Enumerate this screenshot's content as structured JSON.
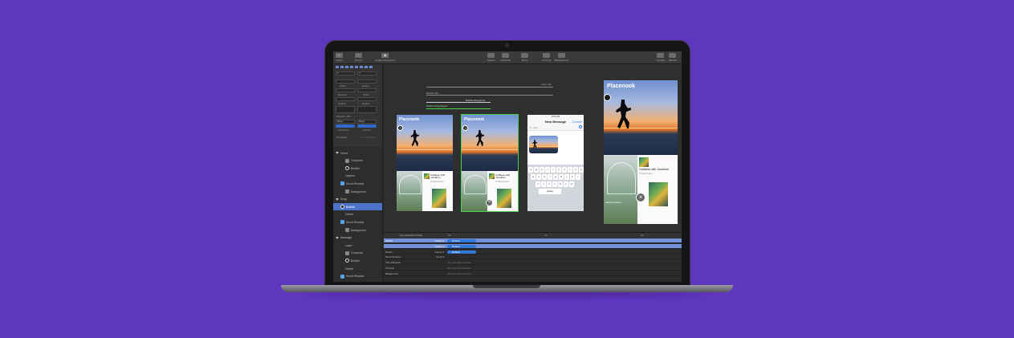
{
  "toolbar": {
    "left": [
      {
        "label": "Import",
        "icon": "import-icon"
      },
      {
        "label": "Export",
        "icon": "export-icon"
      },
      {
        "label": "Create Component",
        "icon": "component-icon"
      }
    ],
    "center": [
      {
        "label": "Screen",
        "icon": "screen-icon"
      },
      {
        "label": "Artboards",
        "icon": "artboard-icon"
      },
      {
        "label": "Mirror",
        "icon": "mirror-icon"
      },
      {
        "label": "Connect",
        "icon": "connect-icon"
      },
      {
        "label": "Backgrounds",
        "icon": "backgrounds-icon"
      }
    ],
    "right": [
      {
        "label": "Tutorials",
        "icon": "tutorials-icon"
      },
      {
        "label": "Manual",
        "icon": "manual-icon"
      }
    ]
  },
  "inspector": {
    "x": "X",
    "y": "Y",
    "width_label": "Width",
    "height_label": "Height",
    "rotation_label": "Rotation",
    "scale_label": "Scale",
    "opacity_label": "Opacity",
    "radius_label": "Radius",
    "shadow_label": "Shadow",
    "blur_label": "Blur",
    "horizontal_label": "Horizontal",
    "vertical_label": "Vertical",
    "drag_value": "Drag",
    "touchable_label": "Touchable",
    "no_selection_label": "Lock Selection"
  },
  "layers": [
    {
      "label": "Home",
      "indent": 0,
      "icon": "disclosure",
      "selected": false
    },
    {
      "label": "Compose",
      "indent": 2,
      "icon": "phone",
      "selected": false
    },
    {
      "label": "Bubble",
      "indent": 2,
      "icon": "circle",
      "selected": false
    },
    {
      "label": "Options",
      "indent": 2,
      "icon": "none",
      "selected": false
    },
    {
      "label": "Scroll Window",
      "indent": 1,
      "icon": "folder",
      "selected": false
    },
    {
      "label": "Background",
      "indent": 2,
      "icon": "image",
      "selected": false
    },
    {
      "label": "Drag",
      "indent": 0,
      "icon": "disclosure",
      "selected": false
    },
    {
      "label": "Bubble",
      "indent": 1,
      "icon": "circle",
      "selected": true
    },
    {
      "label": "Delete",
      "indent": 2,
      "icon": "none",
      "selected": false
    },
    {
      "label": "Scroll Window",
      "indent": 1,
      "icon": "folder",
      "selected": false
    },
    {
      "label": "Background",
      "indent": 2,
      "icon": "image",
      "selected": false
    },
    {
      "label": "Message",
      "indent": 0,
      "icon": "disclosure",
      "selected": false
    },
    {
      "label": "Layer",
      "indent": 2,
      "icon": "none",
      "selected": false
    },
    {
      "label": "Compose",
      "indent": 2,
      "icon": "phone",
      "selected": false
    },
    {
      "label": "Bubble",
      "indent": 2,
      "icon": "circle",
      "selected": false
    },
    {
      "label": "Delete",
      "indent": 2,
      "icon": "none",
      "selected": false
    },
    {
      "label": "Scroll Window",
      "indent": 1,
      "icon": "folder",
      "selected": false
    }
  ],
  "canvas": {
    "flow_labels": {
      "layer_tap": "Layer Tap",
      "bubble_tap": "Bubble Tap",
      "drag_ends": "Bubble Drag Ends",
      "drag_begins": "Bubble Drag Begins"
    },
    "app_title": "Placenook",
    "badge_number": "3",
    "card_title": "Kathleen with Jonathan",
    "card_subtitle": "Posted Here",
    "message": {
      "status_time": "10:00 AM",
      "title": "New Message",
      "cancel": "Cancel",
      "to": "To: Jane"
    },
    "keyboard_rows": [
      [
        "q",
        "w",
        "e",
        "r",
        "t",
        "y",
        "u",
        "i",
        "o",
        "p"
      ],
      [
        "a",
        "s",
        "d",
        "f",
        "g",
        "h",
        "j",
        "k",
        "l"
      ],
      [
        "z",
        "x",
        "c",
        "v",
        "b",
        "n",
        "m"
      ]
    ],
    "keyboard_space": "space"
  },
  "preview": {
    "app_title": "Placenook",
    "card_title": "Kathleen with Jonathan",
    "card_subtitle": "Posted Here",
    "caption": "Sandra Kitchen"
  },
  "timeline": {
    "header": "Any Artboard to Drag",
    "markers": [
      "0s",
      "1s",
      "2s"
    ],
    "rows": [
      {
        "name": "Bubble",
        "curve": "Center ▾",
        "bar": "Default",
        "selected": true
      },
      {
        "name": "",
        "curve": "Center ▾",
        "bar": "Default",
        "selected": true
      },
      {
        "name": "Delete",
        "curve": "Center ▾",
        "bar": "Default",
        "selected": false
      },
      {
        "name": "Scroll Window",
        "curve": "Scroll ▾",
        "note": "",
        "selected": false
      },
      {
        "name": "The Artboards",
        "curve": "",
        "note": "All properties identical",
        "selected": false
      },
      {
        "name": "Timeline",
        "curve": "",
        "note": "All properties identical",
        "selected": false
      },
      {
        "name": "Background",
        "curve": "",
        "note": "All properties identical",
        "selected": false
      }
    ]
  },
  "colors": {
    "background": "#5f37bf",
    "selection": "#4c73c9",
    "highlight": "#49d14f",
    "timeline_bar": "#3178d8"
  }
}
